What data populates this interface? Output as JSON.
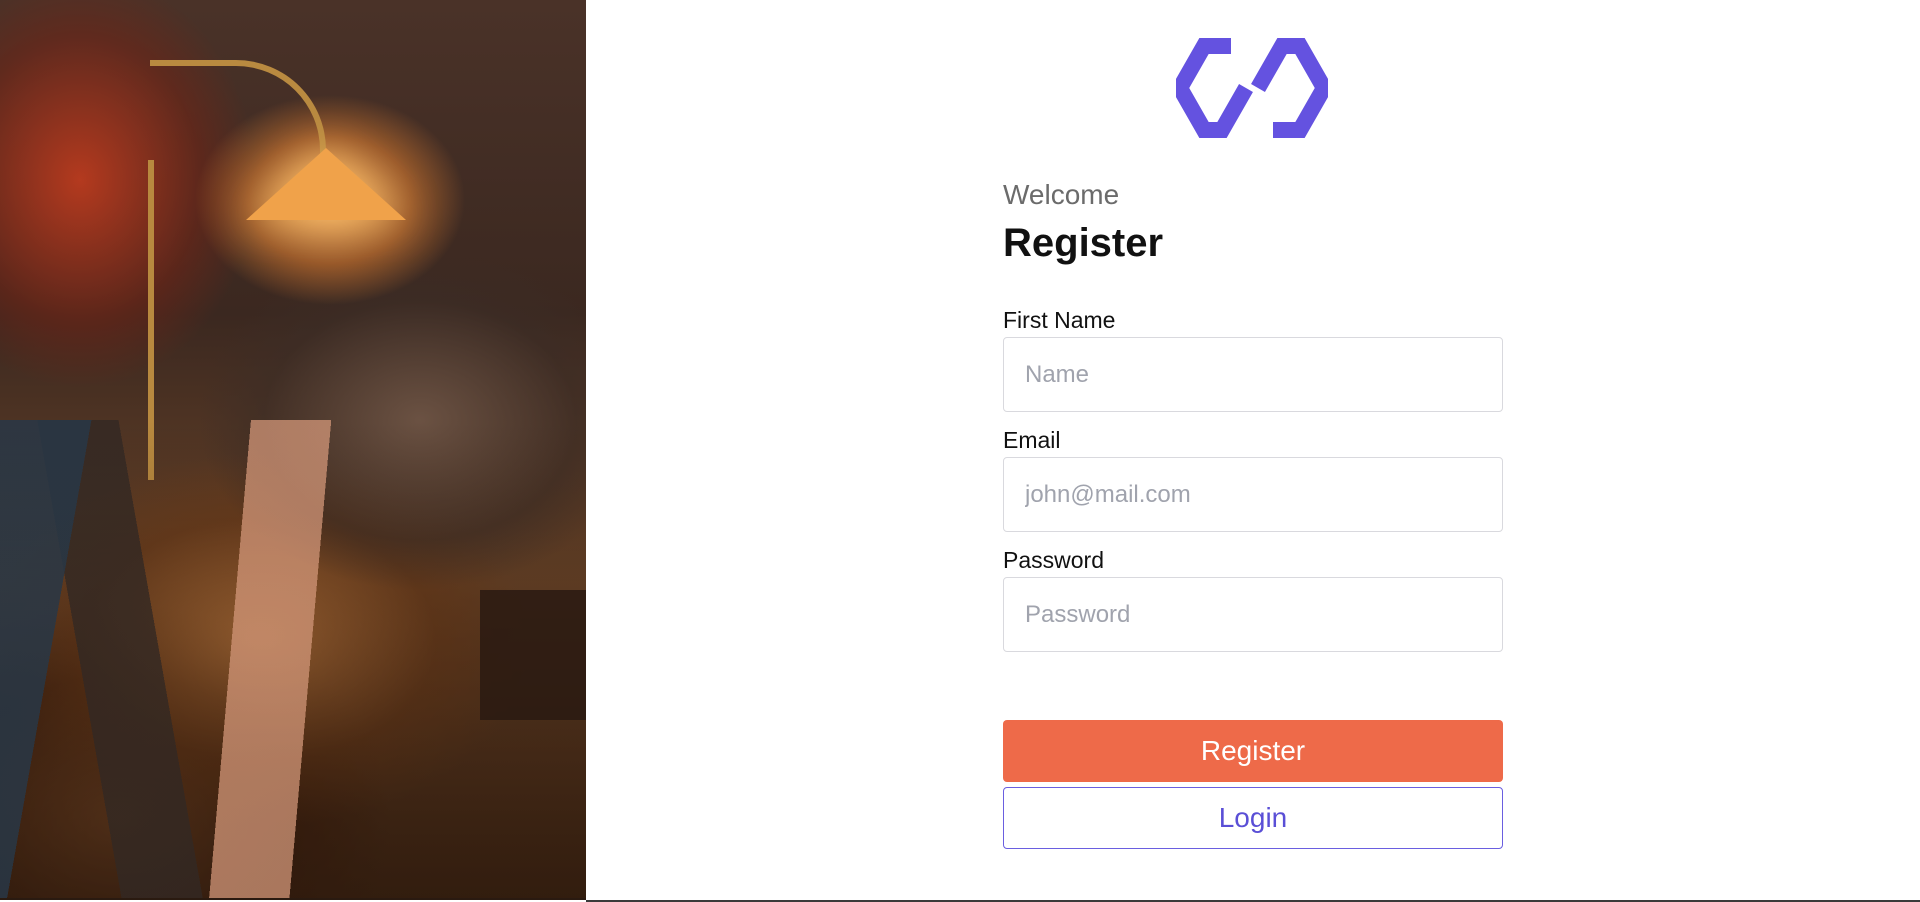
{
  "brand": {
    "logo_icon": "infinity-link-logo-icon",
    "accent_color": "#6452e0"
  },
  "header": {
    "welcome": "Welcome",
    "title": "Register"
  },
  "form": {
    "first_name": {
      "label": "First Name",
      "placeholder": "Name",
      "value": ""
    },
    "email": {
      "label": "Email",
      "placeholder": "john@mail.com",
      "value": ""
    },
    "password": {
      "label": "Password",
      "placeholder": "Password",
      "value": ""
    }
  },
  "actions": {
    "register_label": "Register",
    "register_color": "#ee6a49",
    "login_label": "Login",
    "login_color": "#5a4fd6"
  },
  "hero": {
    "image_subject": "bookshop-interior-photo"
  }
}
